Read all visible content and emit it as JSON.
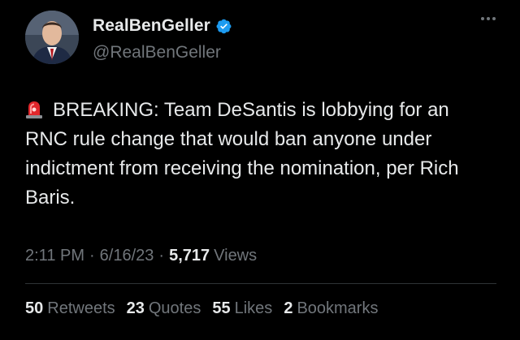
{
  "author": {
    "display_name": "RealBenGeller",
    "handle": "@RealBenGeller",
    "verified_color": "#1d9bf0"
  },
  "tweet": {
    "emoji": "siren-icon",
    "text": "BREAKING: Team DeSantis is lobbying for an RNC rule change that would ban anyone under indictment from receiving the nomination, per Rich Baris."
  },
  "meta": {
    "time": "2:11 PM",
    "date": "6/16/23",
    "views_count": "5,717",
    "views_label": "Views"
  },
  "stats": [
    {
      "count": "50",
      "label": "Retweets"
    },
    {
      "count": "23",
      "label": "Quotes"
    },
    {
      "count": "55",
      "label": "Likes"
    },
    {
      "count": "2",
      "label": "Bookmarks"
    }
  ]
}
